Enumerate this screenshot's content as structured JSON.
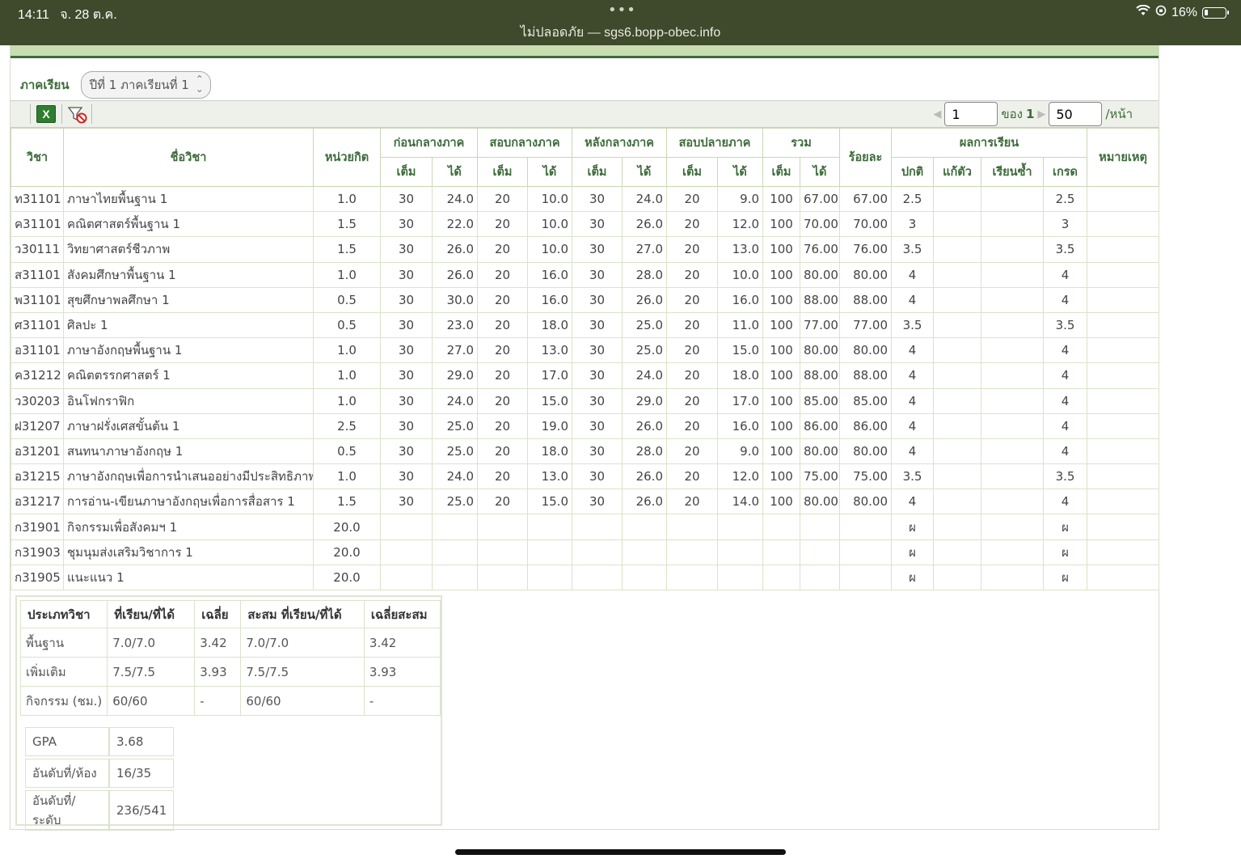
{
  "status": {
    "time": "14:11",
    "date": "จ. 28 ต.ค.",
    "url": "ไม่ปลอดภัย — sgs6.bopp-obec.info",
    "battery": "16%"
  },
  "term": {
    "label": "ภาคเรียน",
    "selected": "ปีที่ 1 ภาคเรียนที่ 1"
  },
  "toolbar": {
    "excel_icon": "excel-icon",
    "clear_filter_icon": "clear-filter-icon"
  },
  "pager": {
    "page": "1",
    "of_label": "ของ",
    "total_pages": "1",
    "page_size": "50",
    "per_page_label": "/หน้า"
  },
  "table": {
    "headers": {
      "code": "วิชา",
      "name": "ชื่อวิชา",
      "credit": "หน่วยกิต",
      "pre_mid": "ก่อนกลางภาค",
      "mid": "สอบกลางภาค",
      "post_mid": "หลังกลางภาค",
      "final": "สอบปลายภาค",
      "total": "รวม",
      "percent": "ร้อยละ",
      "result": "ผลการเรียน",
      "note": "หมายเหตุ",
      "full": "เต็ม",
      "got": "ได้",
      "normal": "ปกติ",
      "fix": "แก้ตัว",
      "repeat": "เรียนซ้ำ",
      "grade": "เกรด"
    },
    "rows": [
      [
        "ท31101",
        "ภาษาไทยพื้นฐาน 1",
        "1.0",
        "30",
        "24.0",
        "20",
        "10.0",
        "30",
        "24.0",
        "20",
        "9.0",
        "100",
        "67.00",
        "67.00",
        "2.5",
        "",
        "",
        "2.5",
        ""
      ],
      [
        "ค31101",
        "คณิตศาสตร์พื้นฐาน 1",
        "1.5",
        "30",
        "22.0",
        "20",
        "10.0",
        "30",
        "26.0",
        "20",
        "12.0",
        "100",
        "70.00",
        "70.00",
        "3",
        "",
        "",
        "3",
        ""
      ],
      [
        "ว30111",
        "วิทยาศาสตร์ชีวภาพ",
        "1.5",
        "30",
        "26.0",
        "20",
        "10.0",
        "30",
        "27.0",
        "20",
        "13.0",
        "100",
        "76.00",
        "76.00",
        "3.5",
        "",
        "",
        "3.5",
        ""
      ],
      [
        "ส31101",
        "สังคมศึกษาพื้นฐาน 1",
        "1.0",
        "30",
        "26.0",
        "20",
        "16.0",
        "30",
        "28.0",
        "20",
        "10.0",
        "100",
        "80.00",
        "80.00",
        "4",
        "",
        "",
        "4",
        ""
      ],
      [
        "พ31101",
        "สุขศึกษาพลศึกษา 1",
        "0.5",
        "30",
        "30.0",
        "20",
        "16.0",
        "30",
        "26.0",
        "20",
        "16.0",
        "100",
        "88.00",
        "88.00",
        "4",
        "",
        "",
        "4",
        ""
      ],
      [
        "ศ31101",
        "ศิลปะ 1",
        "0.5",
        "30",
        "23.0",
        "20",
        "18.0",
        "30",
        "25.0",
        "20",
        "11.0",
        "100",
        "77.00",
        "77.00",
        "3.5",
        "",
        "",
        "3.5",
        ""
      ],
      [
        "อ31101",
        "ภาษาอังกฤษพื้นฐาน 1",
        "1.0",
        "30",
        "27.0",
        "20",
        "13.0",
        "30",
        "25.0",
        "20",
        "15.0",
        "100",
        "80.00",
        "80.00",
        "4",
        "",
        "",
        "4",
        ""
      ],
      [
        "ค31212",
        "คณิตตรรกศาสตร์ 1",
        "1.0",
        "30",
        "29.0",
        "20",
        "17.0",
        "30",
        "24.0",
        "20",
        "18.0",
        "100",
        "88.00",
        "88.00",
        "4",
        "",
        "",
        "4",
        ""
      ],
      [
        "ว30203",
        "อินโฟกราฟิก",
        "1.0",
        "30",
        "24.0",
        "20",
        "15.0",
        "30",
        "29.0",
        "20",
        "17.0",
        "100",
        "85.00",
        "85.00",
        "4",
        "",
        "",
        "4",
        ""
      ],
      [
        "ฝ31207",
        "ภาษาฝรั่งเศสขั้นต้น 1",
        "2.5",
        "30",
        "25.0",
        "20",
        "19.0",
        "30",
        "26.0",
        "20",
        "16.0",
        "100",
        "86.00",
        "86.00",
        "4",
        "",
        "",
        "4",
        ""
      ],
      [
        "อ31201",
        "สนทนาภาษาอังกฤษ 1",
        "0.5",
        "30",
        "25.0",
        "20",
        "18.0",
        "30",
        "28.0",
        "20",
        "9.0",
        "100",
        "80.00",
        "80.00",
        "4",
        "",
        "",
        "4",
        ""
      ],
      [
        "อ31215",
        "ภาษาอังกฤษเพื่อการนำเสนออย่างมีประสิทธิภาพ",
        "1.0",
        "30",
        "24.0",
        "20",
        "13.0",
        "30",
        "26.0",
        "20",
        "12.0",
        "100",
        "75.00",
        "75.00",
        "3.5",
        "",
        "",
        "3.5",
        ""
      ],
      [
        "อ31217",
        "การอ่าน-เขียนภาษาอังกฤษเพื่อการสื่อสาร 1",
        "1.5",
        "30",
        "25.0",
        "20",
        "15.0",
        "30",
        "26.0",
        "20",
        "14.0",
        "100",
        "80.00",
        "80.00",
        "4",
        "",
        "",
        "4",
        ""
      ],
      [
        "ก31901",
        "กิจกรรมเพื่อสังคมฯ 1",
        "20.0",
        "",
        "",
        "",
        "",
        "",
        "",
        "",
        "",
        "",
        "",
        "",
        "ผ",
        "",
        "",
        "ผ",
        ""
      ],
      [
        "ก31903",
        "ชุมนุมส่งเสริมวิชาการ 1",
        "20.0",
        "",
        "",
        "",
        "",
        "",
        "",
        "",
        "",
        "",
        "",
        "",
        "ผ",
        "",
        "",
        "ผ",
        ""
      ],
      [
        "ก31905",
        "แนะแนว 1",
        "20.0",
        "",
        "",
        "",
        "",
        "",
        "",
        "",
        "",
        "",
        "",
        "",
        "ผ",
        "",
        "",
        "ผ",
        ""
      ]
    ]
  },
  "summary": {
    "headers": [
      "ประเภทวิชา",
      "ที่เรียน/ที่ได้",
      "เฉลี่ย",
      "สะสม ที่เรียน/ที่ได้",
      "เฉลี่ยสะสม"
    ],
    "rows": [
      [
        "พื้นฐาน",
        "7.0/7.0",
        "3.42",
        "7.0/7.0",
        "3.42"
      ],
      [
        "เพิ่มเติม",
        "7.5/7.5",
        "3.93",
        "7.5/7.5",
        "3.93"
      ],
      [
        "กิจกรรม (ชม.)",
        "60/60",
        "-",
        "60/60",
        "-"
      ]
    ],
    "gpa_label": "GPA",
    "gpa": "3.68",
    "class_rank_label": "อันดับที่/ห้อง",
    "class_rank": "16/35",
    "level_rank_label": "อันดับที่/ระดับ",
    "level_rank": "236/541"
  }
}
